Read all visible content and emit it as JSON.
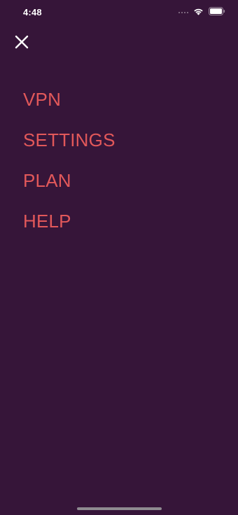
{
  "status_bar": {
    "time": "4:48",
    "icons": [
      "signal-icon",
      "wifi-icon",
      "battery-icon"
    ]
  },
  "header": {
    "close_icon": "close-icon"
  },
  "menu": {
    "items": [
      {
        "label": "VPN"
      },
      {
        "label": "SETTINGS"
      },
      {
        "label": "PLAN"
      },
      {
        "label": "HELP"
      }
    ]
  },
  "colors": {
    "background": "#361539",
    "menu_text": "#e2585a",
    "icon": "#ffffff"
  }
}
